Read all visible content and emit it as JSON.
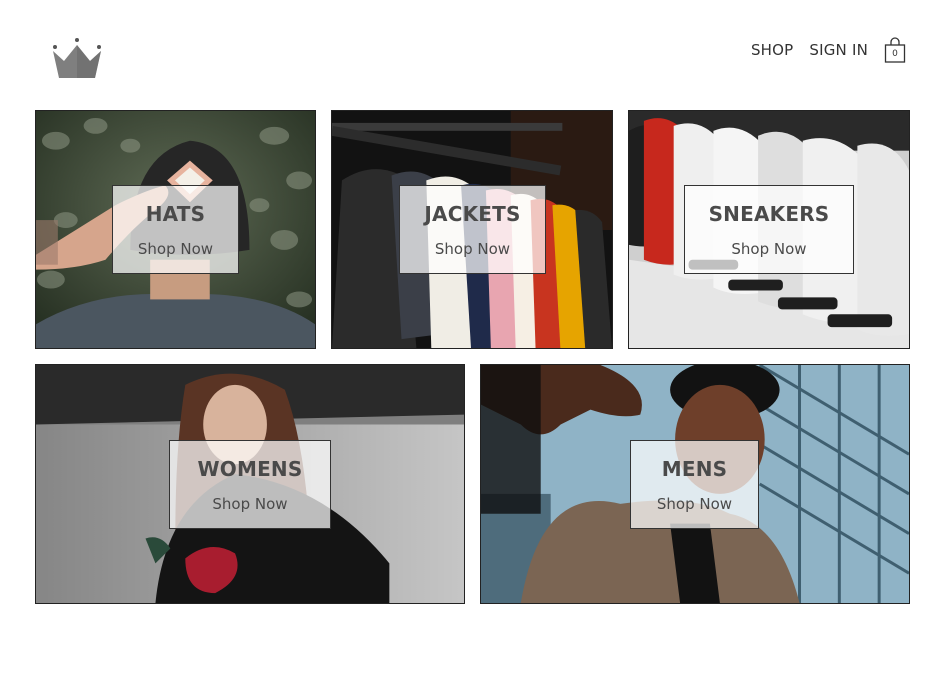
{
  "header": {
    "logo_icon": "crown-icon",
    "nav": {
      "shop_label": "SHOP",
      "signin_label": "SIGN IN"
    },
    "cart": {
      "icon": "shopping-bag-icon",
      "count": "0"
    }
  },
  "categories": [
    {
      "title": "HATS",
      "cta": "Shop Now"
    },
    {
      "title": "JACKETS",
      "cta": "Shop Now"
    },
    {
      "title": "SNEAKERS",
      "cta": "Shop Now"
    },
    {
      "title": "WOMENS",
      "cta": "Shop Now"
    },
    {
      "title": "MENS",
      "cta": "Shop Now"
    }
  ],
  "colors": {
    "text": "#333333",
    "overlay": "rgba(255,255,255,0.72)",
    "logo": "#808080"
  }
}
